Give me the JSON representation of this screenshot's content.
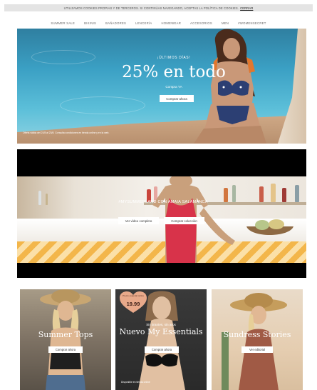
{
  "cookie": {
    "text": "UTILIZAMOS COOKIES PROPIAS Y DE TERCEROS. SI CONTINÚAS NAVEGANDO, ACEPTAS LA POLÍTICA DE COOKIES.",
    "link": "CERRAR"
  },
  "nav": [
    "SUMMER SALE",
    "BIKINIS",
    "BAÑADORES",
    "LENCERÍA",
    "HOMEWEAR",
    "ACCESORIOS",
    "MEN",
    "#WOMENSECRET"
  ],
  "hero": {
    "eyebrow": "¡ÚLTIMOS DÍAS!",
    "headline": "25% en todo",
    "sub": "Compra YA",
    "button": "Comprar ahora",
    "legal": "Oferta válida del 21/8 al 23/8. Consulta condiciones en tienda online y en la web."
  },
  "video": {
    "tag": "#MYSUMMERLAND CON AMAIA SALAMANCA",
    "button1": "Ver vídeo completo",
    "button2": "Comprar colección"
  },
  "cards": [
    {
      "title": "Summer Tops",
      "button": "Comprar ahora"
    },
    {
      "badge_label": "Precio especial online",
      "badge_price": "19.99",
      "kicker": "Sin tirantes, sin aros",
      "title": "Nuevo My Essentials",
      "button": "Comprar ahora",
      "small": "Disponible en tienda online"
    },
    {
      "title": "Sundress Stories",
      "button": "Ver editorial"
    }
  ],
  "colors": {
    "badge": "#e8a98a",
    "cta_bg": "#ffffff",
    "cookie_bg": "#e4e4e4"
  }
}
